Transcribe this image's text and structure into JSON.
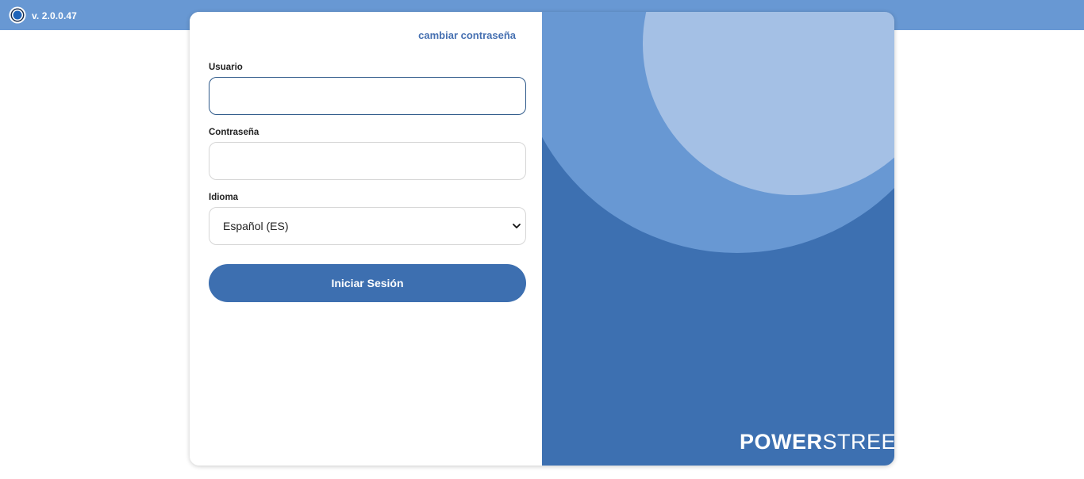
{
  "topbar": {
    "version": "v. 2.0.0.47",
    "logo_icon": "app-logo-icon"
  },
  "form": {
    "change_password": "cambiar contraseña",
    "user_label": "Usuario",
    "user_value": "",
    "password_label": "Contraseña",
    "password_value": "",
    "language_label": "Idioma",
    "language_selected": "Español (ES)",
    "login_button": "Iniciar Sesión"
  },
  "brand": {
    "logo_text_part1": "POWER",
    "logo_text_part2": "STREET"
  },
  "colors": {
    "topbar": "#6898d3",
    "accent": "#3d6fb0",
    "panel_light": "#6898d3",
    "panel_lighter": "#a4c0e5",
    "link": "#4670b1"
  }
}
